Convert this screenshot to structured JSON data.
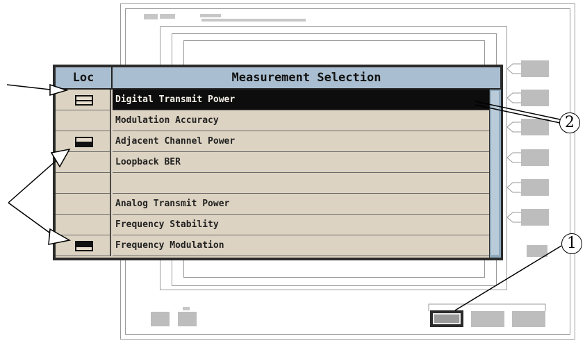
{
  "dialog": {
    "loc_header": "Loc",
    "title": "Measurement Selection",
    "rows": [
      {
        "label": "Digital Transmit Power",
        "loc_icon": "both-halves-outlined",
        "selected": true
      },
      {
        "label": "Modulation Accuracy",
        "loc_icon": "none",
        "selected": false
      },
      {
        "label": "Adjacent Channel Power",
        "loc_icon": "bottom-half-filled",
        "selected": false
      },
      {
        "label": "Loopback BER",
        "loc_icon": "none",
        "selected": false
      },
      {
        "label": "",
        "loc_icon": "none",
        "selected": false
      },
      {
        "label": "Analog Transmit Power",
        "loc_icon": "none",
        "selected": false
      },
      {
        "label": "Frequency Stability",
        "loc_icon": "none",
        "selected": false
      },
      {
        "label": "Frequency Modulation",
        "loc_icon": "top-half-filled",
        "selected": false
      }
    ]
  },
  "callouts": {
    "one": "1",
    "two": "2"
  },
  "colors": {
    "header_bg": "#a9bfd1",
    "row_bg": "#ddd3c2",
    "selected_bg": "#0d0d0d",
    "dialog_border": "#2b2b2b"
  }
}
